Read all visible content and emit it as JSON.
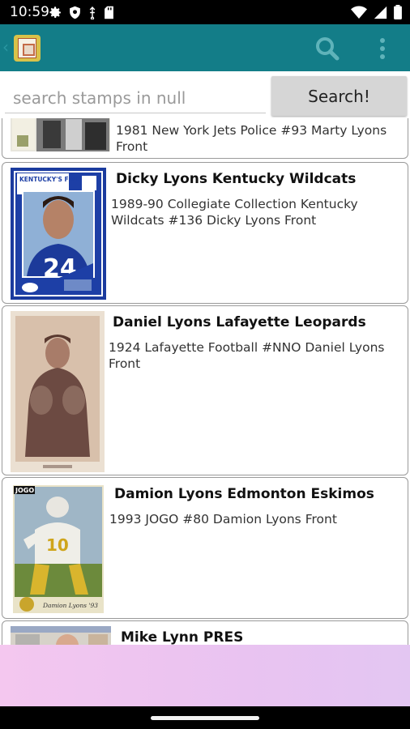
{
  "status_bar": {
    "time": "10:59",
    "icons_left": [
      "gear-icon",
      "shield-icon",
      "usb-icon",
      "sd-card-icon"
    ],
    "icons_right": [
      "wifi-icon",
      "signal-icon",
      "battery-icon"
    ]
  },
  "app_bar": {
    "background": "#137d88",
    "actions": [
      "search-icon",
      "overflow-menu-icon"
    ]
  },
  "search": {
    "placeholder": "search stamps in null",
    "value": "",
    "button_label": "Search!"
  },
  "results": [
    {
      "title": "",
      "description": "1981 New York Jets Police #93 Marty Lyons Front"
    },
    {
      "title": "Dicky Lyons Kentucky Wildcats",
      "description": "1989-90 Collegiate Collection Kentucky Wildcats #136 Dicky Lyons Front",
      "card_header_text": "KENTUCKY'S FINEST",
      "jersey_number": "24"
    },
    {
      "title": "Daniel Lyons Lafayette Leopards",
      "description": "1924 Lafayette Football #NNO Daniel Lyons Front"
    },
    {
      "title": "Damion Lyons Edmonton Eskimos",
      "description": "1993 JOGO #80 Damion Lyons Front",
      "card_brand": "JOGO",
      "card_caption": "Damion Lyons '93",
      "jersey_number": "10"
    },
    {
      "title": "Mike Lynn PRES",
      "description": ""
    }
  ],
  "colors": {
    "accent": "#137d88",
    "ad_area": "#efc5f0"
  }
}
